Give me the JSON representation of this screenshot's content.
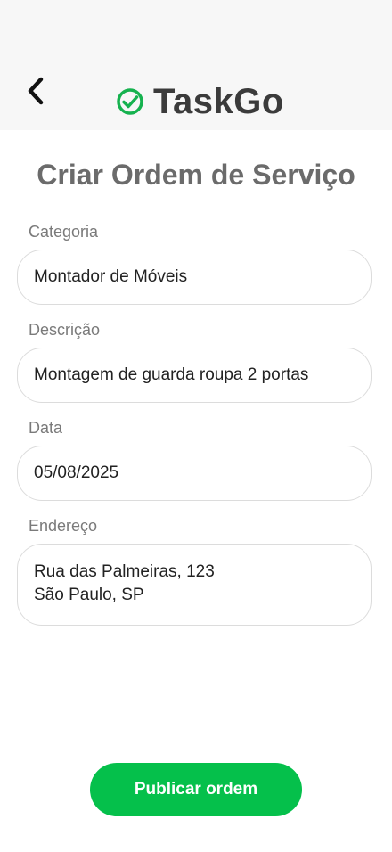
{
  "header": {
    "back_icon": "chevron-left-icon",
    "brand_icon": "check-circle-icon",
    "brand_name": "TaskGo",
    "brand_color": "#16b24f"
  },
  "page": {
    "title": "Criar Ordem de Serviço"
  },
  "form": {
    "category": {
      "label": "Categoria",
      "value": "Montador de Móveis"
    },
    "description": {
      "label": "Descrição",
      "value": "Montagem de guarda roupa 2 portas"
    },
    "date": {
      "label": "Data",
      "value": "05/08/2025"
    },
    "address": {
      "label": "Endereço",
      "line1": "Rua das Palmeiras, 123",
      "line2": "São Paulo, SP"
    }
  },
  "actions": {
    "submit_label": "Publicar ordem",
    "submit_color": "#05c04b"
  }
}
